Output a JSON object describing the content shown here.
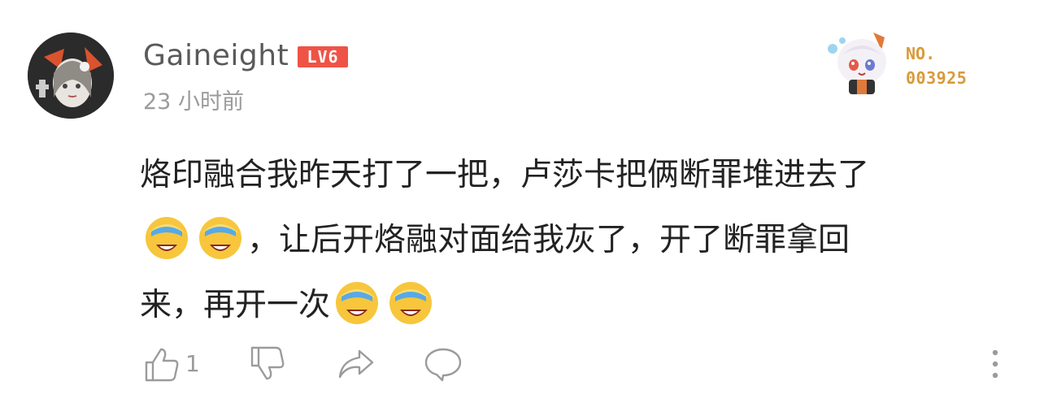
{
  "user": {
    "name": "Gaineight",
    "level_badge": "LV6",
    "time_ago": "23 小时前"
  },
  "medal": {
    "no_label": "NO.",
    "number": "003925"
  },
  "comment": {
    "segments": [
      "烙印融合我昨天打了一把，卢莎卡把俩断罪堆进去了",
      "，让后开烙融对面给我灰了，开了断罪拿回",
      "来，再开一次"
    ],
    "emoji": "laughing-tears-emoji"
  },
  "actions": {
    "like_count": "1",
    "icons": [
      "thumbs-up-icon",
      "thumbs-down-icon",
      "share-icon",
      "comment-icon",
      "more-vertical-icon"
    ]
  },
  "colors": {
    "badge": "#ef5346",
    "medal_text": "#d99a3a",
    "text_primary": "#222222",
    "text_secondary": "#9b9b9b"
  }
}
